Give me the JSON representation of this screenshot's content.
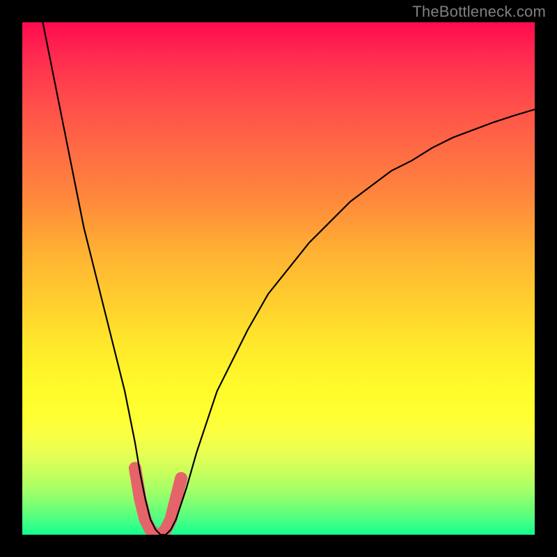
{
  "attribution": "TheBottleneck.com",
  "chart_data": {
    "type": "line",
    "title": "",
    "xlabel": "",
    "ylabel": "",
    "xlim": [
      0,
      100
    ],
    "ylim": [
      0,
      100
    ],
    "grid": false,
    "series": [
      {
        "name": "bottleneck-curve",
        "x": [
          4,
          6,
          8,
          10,
          12,
          14,
          16,
          18,
          20,
          22,
          23,
          24,
          25,
          26,
          27,
          28,
          29,
          30,
          32,
          34,
          36,
          38,
          40,
          44,
          48,
          52,
          56,
          60,
          64,
          68,
          72,
          76,
          80,
          84,
          88,
          92,
          96,
          100
        ],
        "y": [
          100,
          90,
          80,
          70,
          60,
          52,
          44,
          36,
          28,
          18,
          12,
          7,
          3,
          1,
          0,
          0,
          1,
          3,
          9,
          16,
          22,
          28,
          32,
          40,
          47,
          52,
          57,
          61,
          65,
          68,
          71,
          73,
          75.5,
          77.5,
          79,
          80.5,
          81.8,
          83
        ],
        "stroke": "#000000",
        "stroke_width": 2
      },
      {
        "name": "optimal-zone",
        "x": [
          22,
          23,
          24,
          25,
          26,
          27,
          28,
          29,
          30,
          31
        ],
        "y": [
          13,
          7,
          3,
          1,
          0,
          0,
          1,
          3,
          7,
          11
        ],
        "stroke": "#e4646a",
        "stroke_width": 14
      }
    ],
    "gradient_stops": [
      {
        "pos": 0,
        "color": "#ff0b4d"
      },
      {
        "pos": 50,
        "color": "#ffd02e"
      },
      {
        "pos": 80,
        "color": "#fbff40"
      },
      {
        "pos": 100,
        "color": "#12ff90"
      }
    ]
  }
}
